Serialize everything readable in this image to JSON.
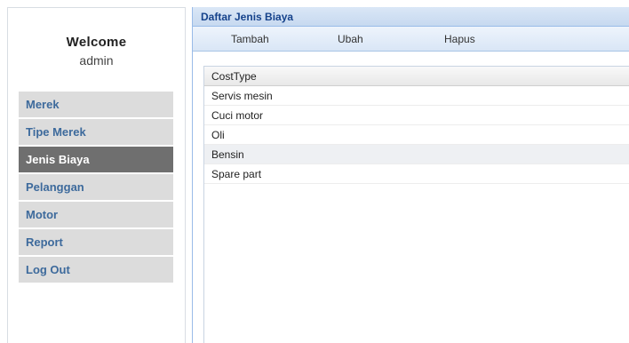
{
  "sidebar": {
    "welcome": "Welcome",
    "user": "admin",
    "items": [
      {
        "label": "Merek"
      },
      {
        "label": "Tipe Merek"
      },
      {
        "label": "Jenis Biaya"
      },
      {
        "label": "Pelanggan"
      },
      {
        "label": "Motor"
      },
      {
        "label": "Report"
      },
      {
        "label": "Log Out"
      }
    ],
    "active_index": 2
  },
  "panel": {
    "title": "Daftar Jenis Biaya",
    "toolbar": {
      "add_label": "Tambah",
      "edit_label": "Ubah",
      "delete_label": "Hapus"
    },
    "grid": {
      "header": "CostType",
      "rows": [
        "Servis mesin",
        "Cuci motor",
        "Oli",
        "Bensin",
        "Spare part"
      ]
    }
  },
  "colors": {
    "menu_text": "#3d6a9c",
    "menu_bg": "#dcdcdc",
    "menu_active_bg": "#6f6f6f",
    "panel_title": "#15428b"
  }
}
